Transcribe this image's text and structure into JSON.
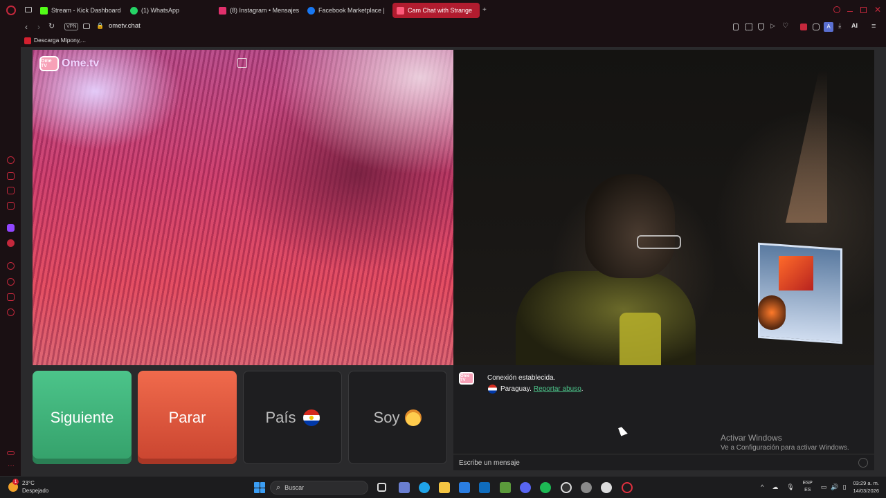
{
  "browser": {
    "tabs": [
      {
        "label": "Stream - Kick Dashboard",
        "color": "#53fc18",
        "active": false
      },
      {
        "label": "(1) WhatsApp",
        "color": "#25d366",
        "active": false
      },
      {
        "label": "(8) Instagram • Mensajes",
        "color": "#e1306c",
        "active": false
      },
      {
        "label": "Facebook Marketplace | F",
        "color": "#1877f2",
        "active": false
      },
      {
        "label": "Cam Chat with Strange",
        "color": "#ff5a7a",
        "active": true
      }
    ],
    "vpn_label": "VPN",
    "url": "ometv.chat",
    "bookmark": "Descarga Mipony,...",
    "ai_label": "AI",
    "account_initial": "A"
  },
  "app": {
    "logo_badge": "Ome TV",
    "logo_text": "Ome.tv"
  },
  "controls": {
    "next_label": "Siguiente",
    "stop_label": "Parar",
    "country_label": "País",
    "iam_label": "Soy"
  },
  "chat": {
    "logo_badge": "Ome TV",
    "status_message": "Conexión establecida.",
    "country": "Paraguay.",
    "report_link": "Reportar abuso",
    "report_suffix": ".",
    "input_placeholder": "Escribe un mensaje"
  },
  "watermark": {
    "title": "Activar Windows",
    "subtitle": "Ve a Configuración para activar Windows."
  },
  "taskbar": {
    "weather_temp": "23°C",
    "weather_desc": "Despejado",
    "weather_badge": "1",
    "search_placeholder": "Buscar",
    "lang_top": "ESP",
    "lang_bottom": "ES",
    "time": "03:29 a. m.",
    "date": "14/03/2026"
  }
}
